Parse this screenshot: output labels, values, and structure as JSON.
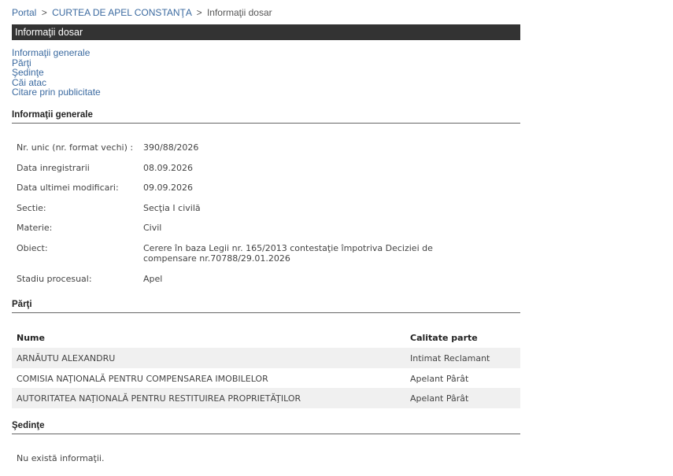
{
  "breadcrumb": {
    "items": [
      "Portal",
      "CURTEA DE APEL CONSTANŢA"
    ],
    "current": "Informaţii dosar",
    "separator": ">"
  },
  "title_bar": {
    "label": "Informaţii dosar"
  },
  "nav_links": [
    "Informaţii generale",
    "Părţi",
    "Şedinţe",
    "Căi atac",
    "Citare prin publicitate"
  ],
  "general": {
    "heading": "Informaţii generale",
    "rows": [
      {
        "label": "Nr. unic (nr. format vechi) :",
        "value": "390/88/2026"
      },
      {
        "label": "Data inregistrarii",
        "value": "08.09.2026"
      },
      {
        "label": "Data ultimei modificari:",
        "value": "09.09.2026"
      },
      {
        "label": "Sectie:",
        "value": "Secţia I civilă"
      },
      {
        "label": "Materie:",
        "value": "Civil"
      },
      {
        "label": "Obiect:",
        "value": "Cerere în baza Legii nr. 165/2013 contestaţie împotriva Deciziei de compensare nr.70788/29.01.2026"
      },
      {
        "label": "Stadiu procesual:",
        "value": "Apel"
      }
    ]
  },
  "parti": {
    "heading": "Părţi",
    "columns": [
      "Nume",
      "Calitate parte"
    ],
    "rows": [
      {
        "nume": "ARNĂUTU ALEXANDRU",
        "calitate": "Intimat Reclamant"
      },
      {
        "nume": "COMISIA NAŢIONALĂ PENTRU COMPENSAREA IMOBILELOR",
        "calitate": "Apelant Pârât"
      },
      {
        "nume": "AUTORITATEA NAŢIONALĂ PENTRU RESTITUIREA PROPRIETĂŢILOR",
        "calitate": "Apelant Pârât"
      }
    ]
  },
  "sedinte": {
    "heading": "Şedinţe",
    "empty_message": "Nu există informaţii."
  },
  "colors": {
    "link": "#3b6aa0",
    "title_bar_bg": "#333333",
    "row_alt_bg": "#f0f0f0"
  }
}
